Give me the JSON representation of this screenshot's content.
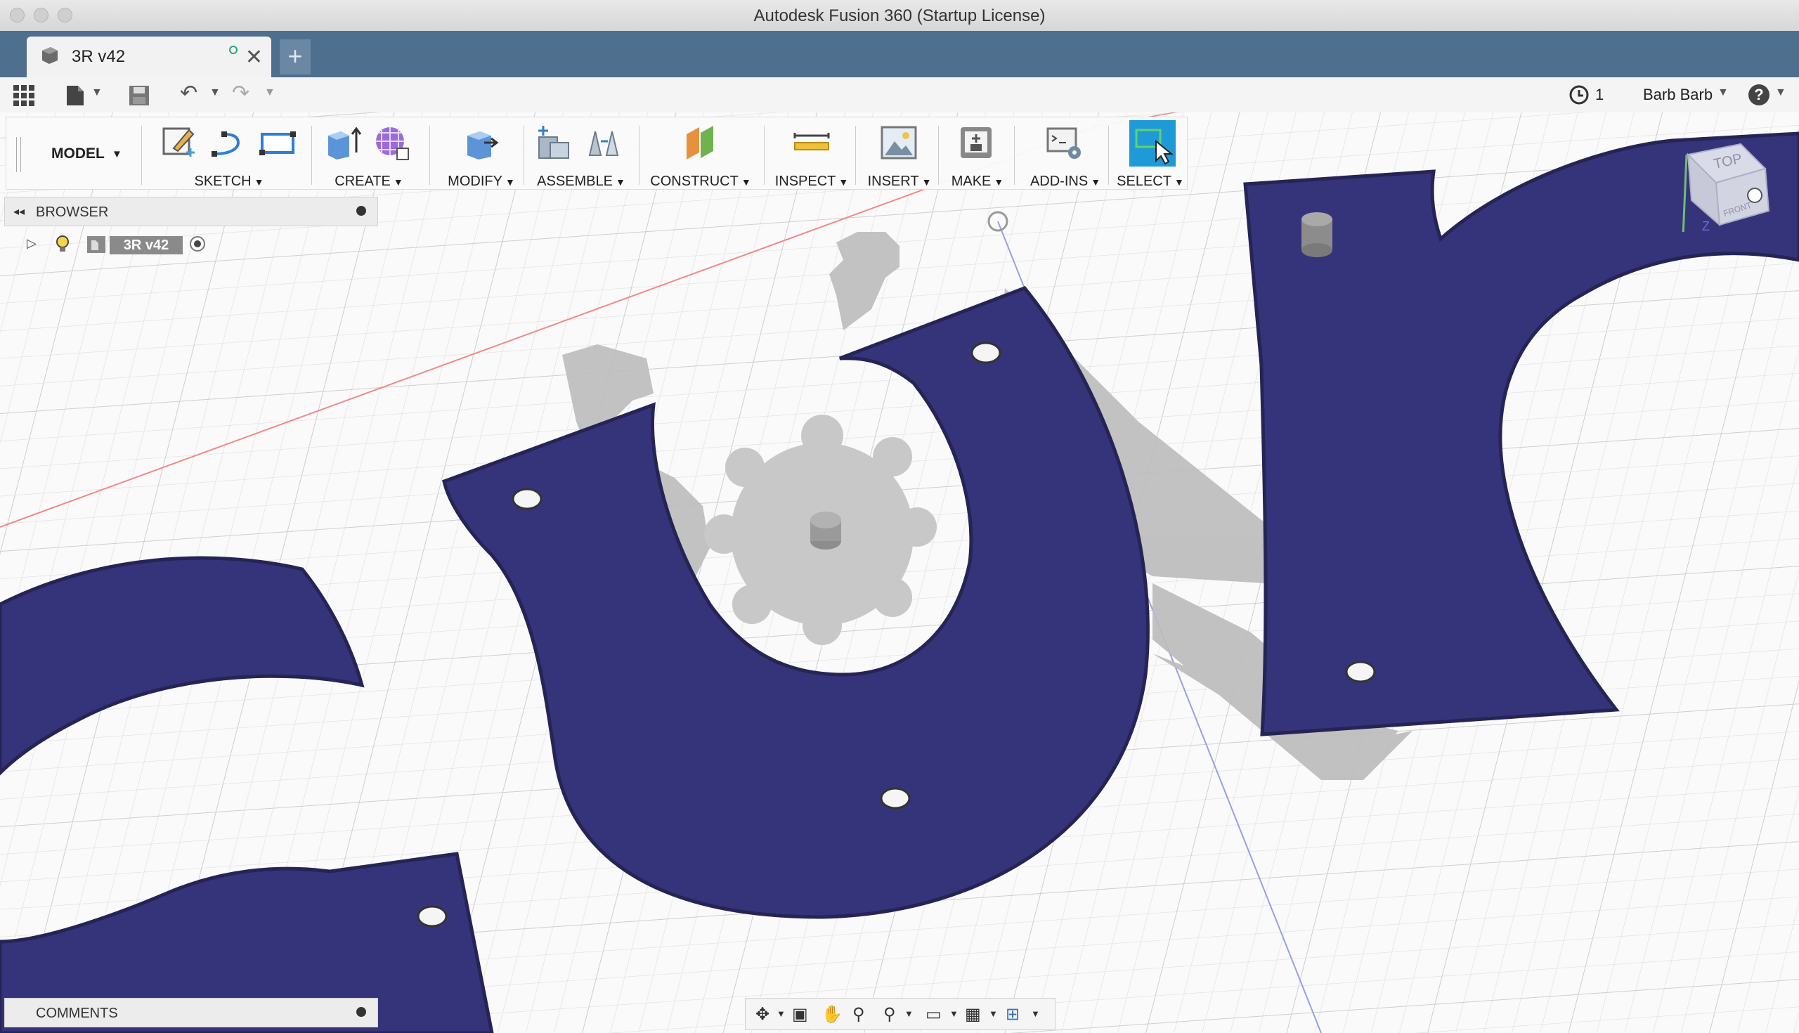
{
  "window": {
    "title": "Autodesk Fusion 360 (Startup License)"
  },
  "document_tab": {
    "title": "3R v42",
    "close_glyph": "✕",
    "new_tab_glyph": "+"
  },
  "quick_access": {
    "job_count": "1",
    "user_name": "Barb Barb",
    "help_glyph": "?"
  },
  "toolbar": {
    "workspace": "MODEL",
    "groups": [
      {
        "label": "SKETCH"
      },
      {
        "label": "CREATE"
      },
      {
        "label": "MODIFY"
      },
      {
        "label": "ASSEMBLE"
      },
      {
        "label": "CONSTRUCT"
      },
      {
        "label": "INSPECT"
      },
      {
        "label": "INSERT"
      },
      {
        "label": "MAKE"
      },
      {
        "label": "ADD-INS"
      },
      {
        "label": "SELECT"
      }
    ]
  },
  "browser": {
    "title": "BROWSER",
    "root_node": "3R v42"
  },
  "comments": {
    "title": "COMMENTS"
  },
  "viewcube": {
    "top": "TOP",
    "front": "FRONT",
    "axis_z": "Z"
  },
  "colors": {
    "part_blue": "#35347a",
    "part_gray": "#b9b9b9",
    "tab_strip": "#4e6f8d",
    "select_blue": "#1e9bd7"
  }
}
